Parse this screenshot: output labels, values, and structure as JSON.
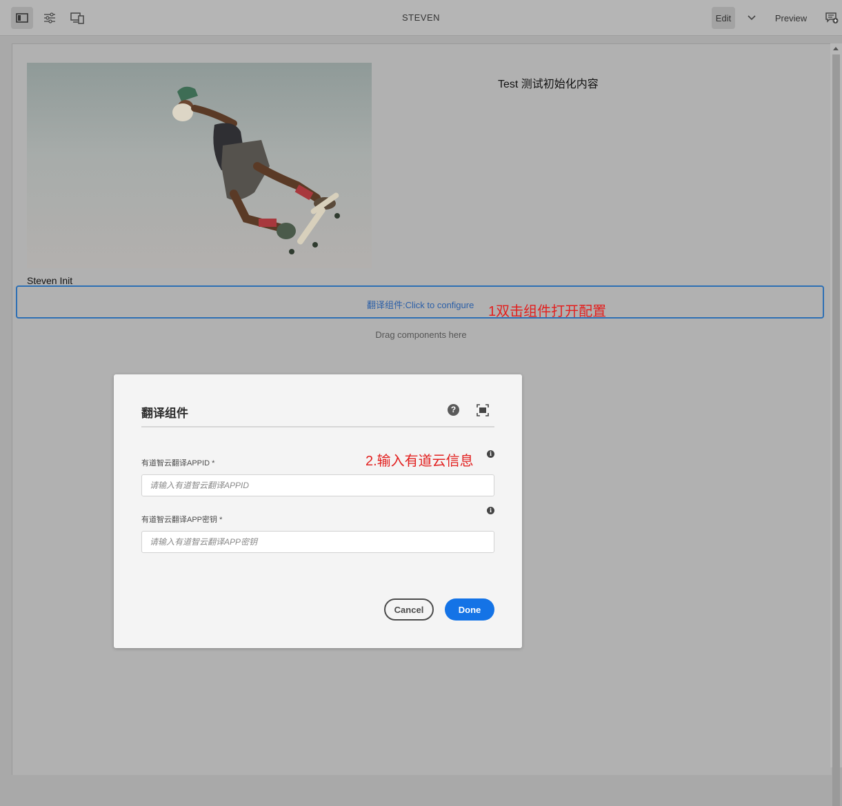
{
  "toolbar": {
    "title": "STEVEN",
    "edit_label": "Edit",
    "preview_label": "Preview",
    "icons": [
      "side-panel-icon",
      "page-properties-icon",
      "emulator-icon",
      "chevron-down-icon",
      "annotations-icon"
    ]
  },
  "page": {
    "test_text": "Test 测试初始化内容",
    "steven_init": "Steven Init",
    "component_placeholder": "翻译组件:Click to configure",
    "drag_here": "Drag components here",
    "annotation_1": "1双击组件打开配置"
  },
  "dialog": {
    "title": "翻译组件",
    "annotation_2": "2.输入有道云信息",
    "fields": [
      {
        "label": "有道智云翻译APPID *",
        "placeholder": "请输入有道智云翻译APPID",
        "value": ""
      },
      {
        "label": "有道智云翻译APP密钥 *",
        "placeholder": "请输入有道智云翻译APP密钥",
        "value": ""
      }
    ],
    "cancel_label": "Cancel",
    "done_label": "Done"
  },
  "colors": {
    "accent": "#1473e6",
    "annotation": "#e2201f",
    "component_border": "#2d6fb4"
  }
}
